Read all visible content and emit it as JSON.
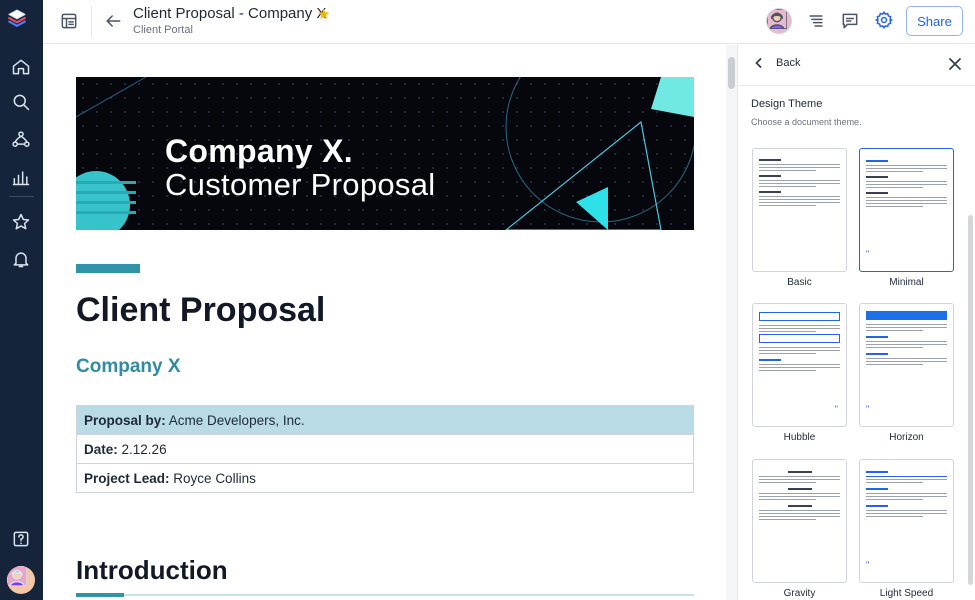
{
  "header": {
    "title": "Client Proposal - Company X",
    "subtitle": "Client Portal",
    "share_label": "Share"
  },
  "document": {
    "banner_line1": "Company X.",
    "banner_line2": "Customer Proposal",
    "heading": "Client Proposal",
    "company": "Company X",
    "info_rows": [
      {
        "label": "Proposal by:",
        "value": "Acme Developers, Inc."
      },
      {
        "label": "Date:",
        "value": "2.12.26"
      },
      {
        "label": "Project Lead:",
        "value": "Royce Collins"
      }
    ],
    "section_heading": "Introduction"
  },
  "panel": {
    "back_label": "Back",
    "title": "Design Theme",
    "subtitle": "Choose a document theme.",
    "themes": [
      {
        "name": "Basic",
        "selected": false
      },
      {
        "name": "Minimal",
        "selected": true
      },
      {
        "name": "Hubble",
        "selected": false
      },
      {
        "name": "Horizon",
        "selected": false
      },
      {
        "name": "Gravity",
        "selected": false
      },
      {
        "name": "Light Speed",
        "selected": false
      }
    ]
  },
  "colors": {
    "rail_bg": "#15233b",
    "accent": "#2f94a8",
    "table_header": "#b8dbe6",
    "primary": "#2563eb",
    "star": "#f5b400"
  },
  "icons": {
    "rail": [
      "layers-logo-icon",
      "home-icon",
      "search-icon",
      "network-icon",
      "bar-chart-icon",
      "star-icon",
      "bell-icon",
      "help-icon"
    ],
    "header": [
      "documents-icon",
      "back-arrow-icon",
      "star-icon",
      "list-icon",
      "comment-icon",
      "gear-icon"
    ]
  }
}
